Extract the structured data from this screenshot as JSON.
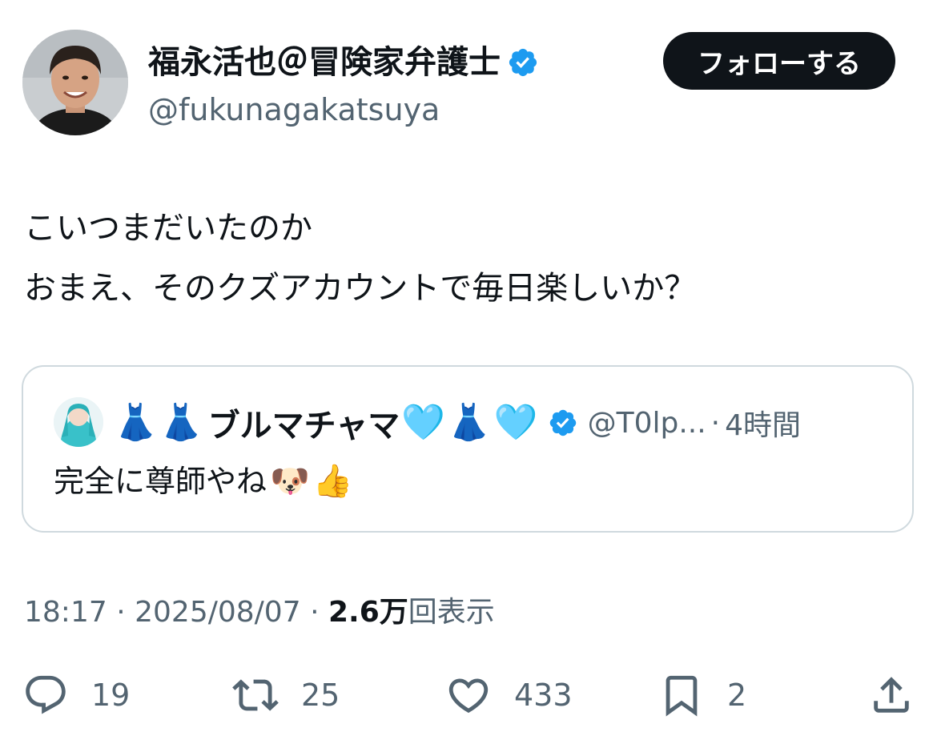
{
  "author": {
    "display_name": "福永活也＠冒険家弁護士",
    "handle": "@fukunagakatsuya",
    "verified": true
  },
  "follow_button": {
    "label": "フォローする"
  },
  "tweet": {
    "lines": [
      "こいつまだいたのか",
      "おまえ、そのクズアカウントで毎日楽しいか？"
    ]
  },
  "quoted": {
    "name_prefix_emoji": [
      "👗",
      "👗"
    ],
    "name": "ブルマチャマ",
    "name_suffix_emoji": [
      "🩵",
      "👗",
      "🩵"
    ],
    "verified": true,
    "handle": "@T0lp...",
    "separator": "·",
    "time": "4時間",
    "text": "完全に尊師やね",
    "text_emoji": [
      "🐶",
      "👍"
    ]
  },
  "meta": {
    "time": "18:17",
    "sep1": "·",
    "date": "2025/08/07",
    "sep2": "·",
    "views_count": "2.6万",
    "views_label": "回表示"
  },
  "actions": {
    "reply_count": "19",
    "retweet_count": "25",
    "like_count": "433",
    "bookmark_count": "2"
  },
  "icons": {
    "verified": "verified-badge-icon",
    "reply": "reply-icon",
    "retweet": "retweet-icon",
    "like": "like-icon",
    "bookmark": "bookmark-icon",
    "share": "share-icon"
  },
  "colors": {
    "verified_blue": "#1d9bf0",
    "text_primary": "#0f1419",
    "text_secondary": "#536471",
    "follow_bg": "#0f1419",
    "border": "#cfd9de"
  }
}
